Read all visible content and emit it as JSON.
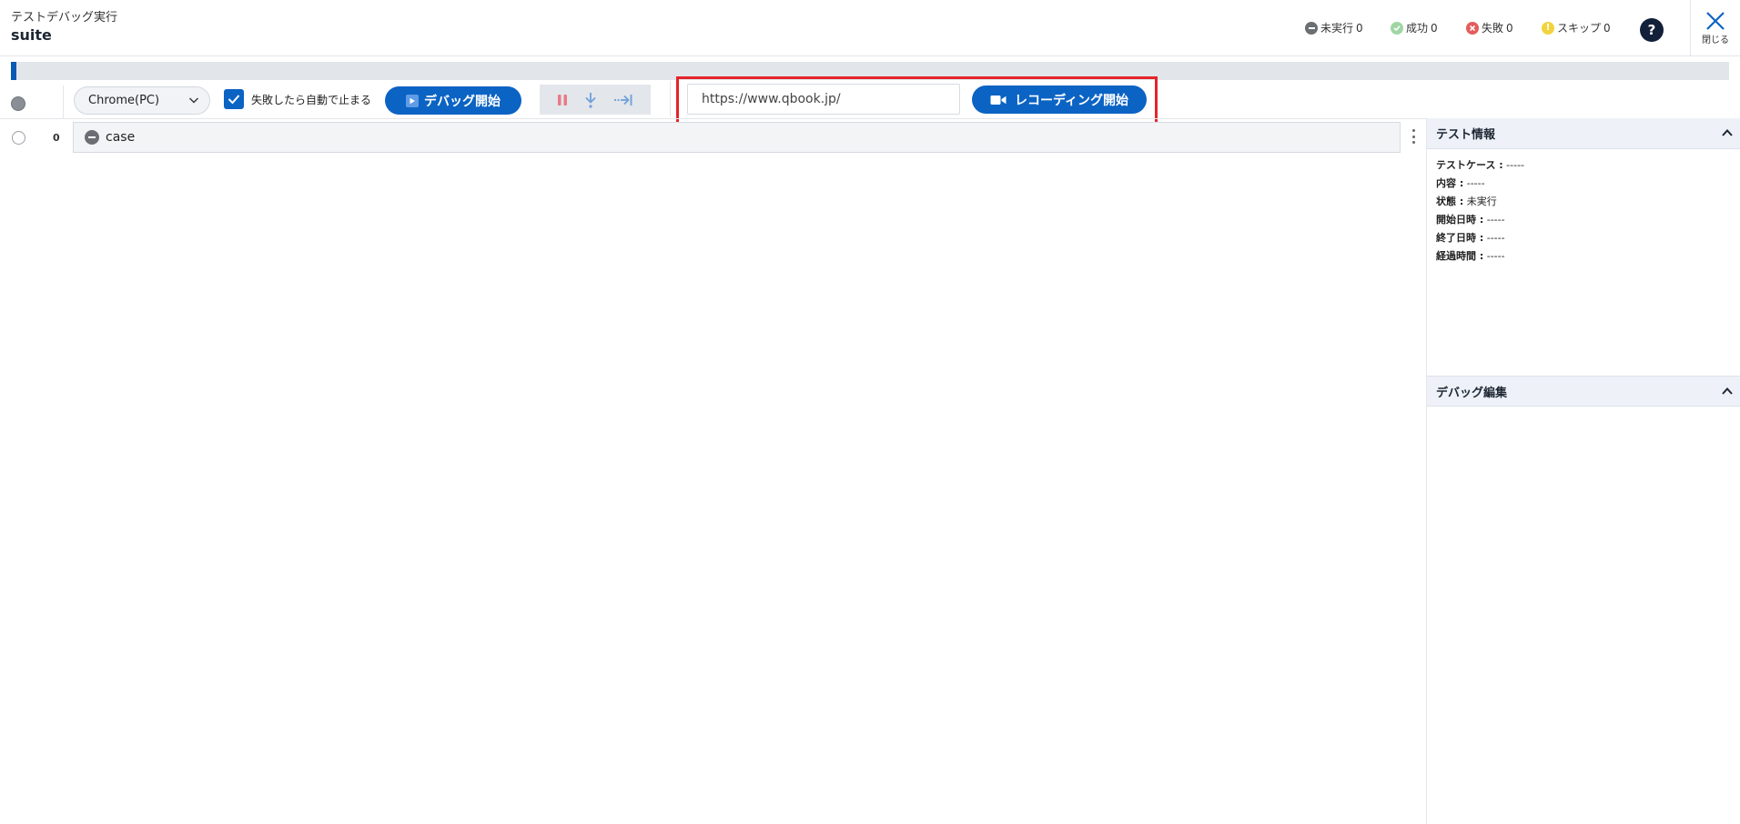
{
  "header": {
    "subtitle": "テストデバッグ実行",
    "title": "suite",
    "statuses": [
      {
        "label": "未実行",
        "count": "0",
        "color": "#6b6f74"
      },
      {
        "label": "成功",
        "count": "0",
        "color": "#9fd6a4"
      },
      {
        "label": "失敗",
        "count": "0",
        "color": "#e55b5b"
      },
      {
        "label": "スキップ",
        "count": "0",
        "color": "#f1d33f"
      }
    ],
    "help_label": "?",
    "close_label": "閉じる"
  },
  "progress": {
    "percent": 0.3
  },
  "toolbar": {
    "browser_value": "Chrome(PC)",
    "stop_on_fail_checked": true,
    "stop_on_fail_label": "失敗したら自動で止まる",
    "debug_start_label": "デバッグ開始",
    "url_value": "https://www.qbook.jp/",
    "recording_start_label": "レコーディング開始",
    "accent_color": "#0b63c4"
  },
  "main": {
    "rows": [
      {
        "index": "0",
        "name": "case"
      }
    ]
  },
  "right_panel": {
    "test_info_title": "テスト情報",
    "info": [
      {
        "key": "テストケース :",
        "value": " -----"
      },
      {
        "key": "内容 :",
        "value": " -----"
      },
      {
        "key": "状態 :",
        "value": " 未実行"
      },
      {
        "key": "開始日時 :",
        "value": " -----"
      },
      {
        "key": "終了日時 :",
        "value": " -----"
      },
      {
        "key": "経過時間 :",
        "value": " -----"
      }
    ],
    "debug_edit_title": "デバッグ編集"
  }
}
